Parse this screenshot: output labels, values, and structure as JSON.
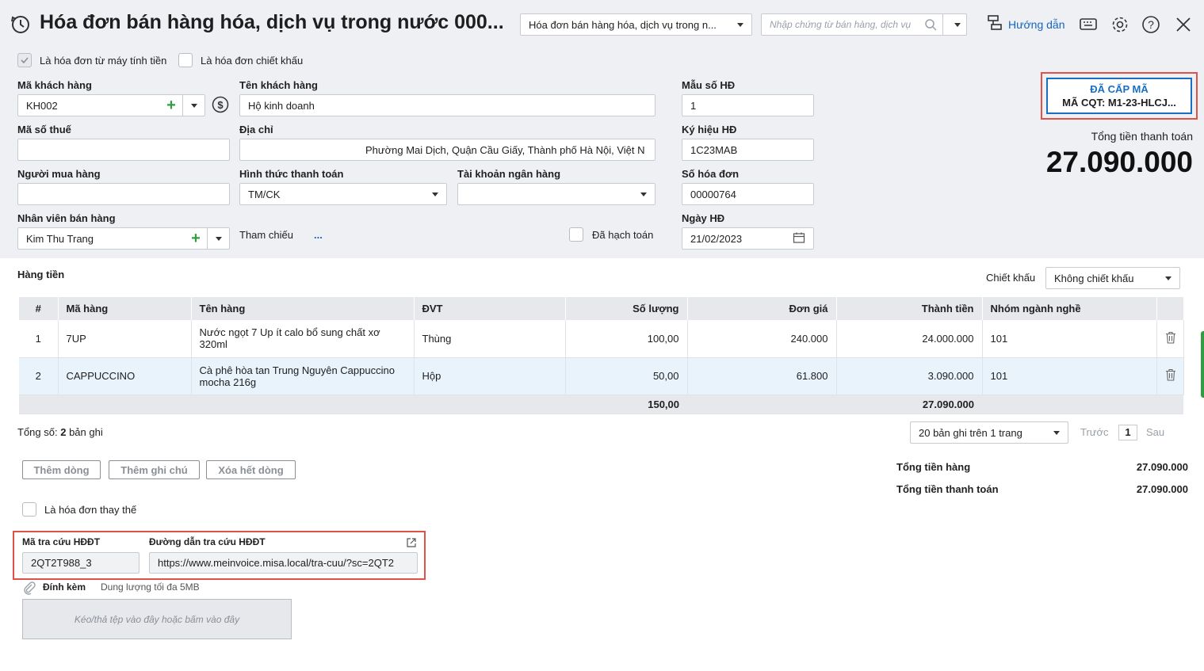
{
  "header": {
    "title": "Hóa đơn bán hàng hóa, dịch vụ trong nước 000...",
    "invoice_type_select": "Hóa đơn bán hàng hóa, dịch vụ trong n...",
    "search_placeholder": "Nhập chứng từ bán hàng, dịch vụ",
    "guide_label": "Hướng dẫn"
  },
  "flags": {
    "from_cash_register": "Là hóa đơn từ máy tính tiền",
    "discount_invoice": "Là hóa đơn chiết khấu"
  },
  "customer": {
    "code_label": "Mã khách hàng",
    "code_value": "KH002",
    "name_label": "Tên khách hàng",
    "name_value": "Hộ kinh doanh",
    "tax_label": "Mã số thuế",
    "tax_value": "",
    "address_label": "Địa chỉ",
    "address_value": "Phường Mai Dịch, Quận Cầu Giấy, Thành phố Hà Nội, Việt N",
    "buyer_label": "Người mua hàng",
    "buyer_value": "",
    "payment_label": "Hình thức thanh toán",
    "payment_value": "TM/CK",
    "bank_label": "Tài khoản ngân hàng",
    "bank_value": "",
    "staff_label": "Nhân viên bán hàng",
    "staff_value": "Kim Thu Trang",
    "reference_label": "Tham chiếu",
    "reference_value": "...",
    "posted_label": "Đã hạch toán"
  },
  "invoice": {
    "form_label": "Mẫu số HĐ",
    "form_value": "1",
    "symbol_label": "Ký hiệu HĐ",
    "symbol_value": "1C23MAB",
    "number_label": "Số hóa đơn",
    "number_value": "00000764",
    "date_label": "Ngày HĐ",
    "date_value": "21/02/2023"
  },
  "status": {
    "line1": "ĐÃ CẤP MÃ",
    "line2": "MÃ CQT: M1-23-HLCJ...",
    "total_label": "Tổng tiền thanh toán",
    "total_value": "27.090.000"
  },
  "goods": {
    "section_label": "Hàng tiền",
    "discount_label": "Chiết khấu",
    "discount_value": "Không chiết khấu",
    "columns": [
      "#",
      "Mã hàng",
      "Tên hàng",
      "ĐVT",
      "Số lượng",
      "Đơn giá",
      "Thành tiền",
      "Nhóm ngành nghề"
    ],
    "rows": [
      {
        "idx": "1",
        "code": "7UP",
        "name": "Nước ngọt 7 Up ít calo bổ sung chất xơ 320ml",
        "unit": "Thùng",
        "qty": "100,00",
        "price": "240.000",
        "amount": "24.000.000",
        "group": "101"
      },
      {
        "idx": "2",
        "code": "CAPPUCCINO",
        "name": "Cà phê hòa tan Trung Nguyên Cappuccino mocha 216g",
        "unit": "Hộp",
        "qty": "50,00",
        "price": "61.800",
        "amount": "3.090.000",
        "group": "101"
      }
    ],
    "footer_qty": "150,00",
    "footer_amount": "27.090.000"
  },
  "pager": {
    "total_prefix": "Tổng số:",
    "total_count": "2",
    "total_suffix": "bản ghi",
    "per_page": "20 bản ghi trên 1 trang",
    "prev": "Trước",
    "page": "1",
    "next": "Sau"
  },
  "actions": {
    "add_row": "Thêm dòng",
    "add_note": "Thêm ghi chú",
    "delete_all": "Xóa hết dòng"
  },
  "summary": {
    "goods_total_label": "Tổng tiền hàng",
    "goods_total_value": "27.090.000",
    "pay_total_label": "Tổng tiền thanh toán",
    "pay_total_value": "27.090.000"
  },
  "replacement_label": "Là hóa đơn thay thế",
  "lookup": {
    "code_label": "Mã tra cứu HĐĐT",
    "code_value": "2QT2T988_3",
    "url_label": "Đường dẫn tra cứu HĐĐT",
    "url_value": "https://www.meinvoice.misa.local/tra-cuu/?sc=2QT2"
  },
  "attachment": {
    "label": "Đính kèm",
    "hint": "Dung lượng tối đa 5MB",
    "dropzone": "Kéo/thả tệp vào đây hoặc bấm vào đây"
  }
}
